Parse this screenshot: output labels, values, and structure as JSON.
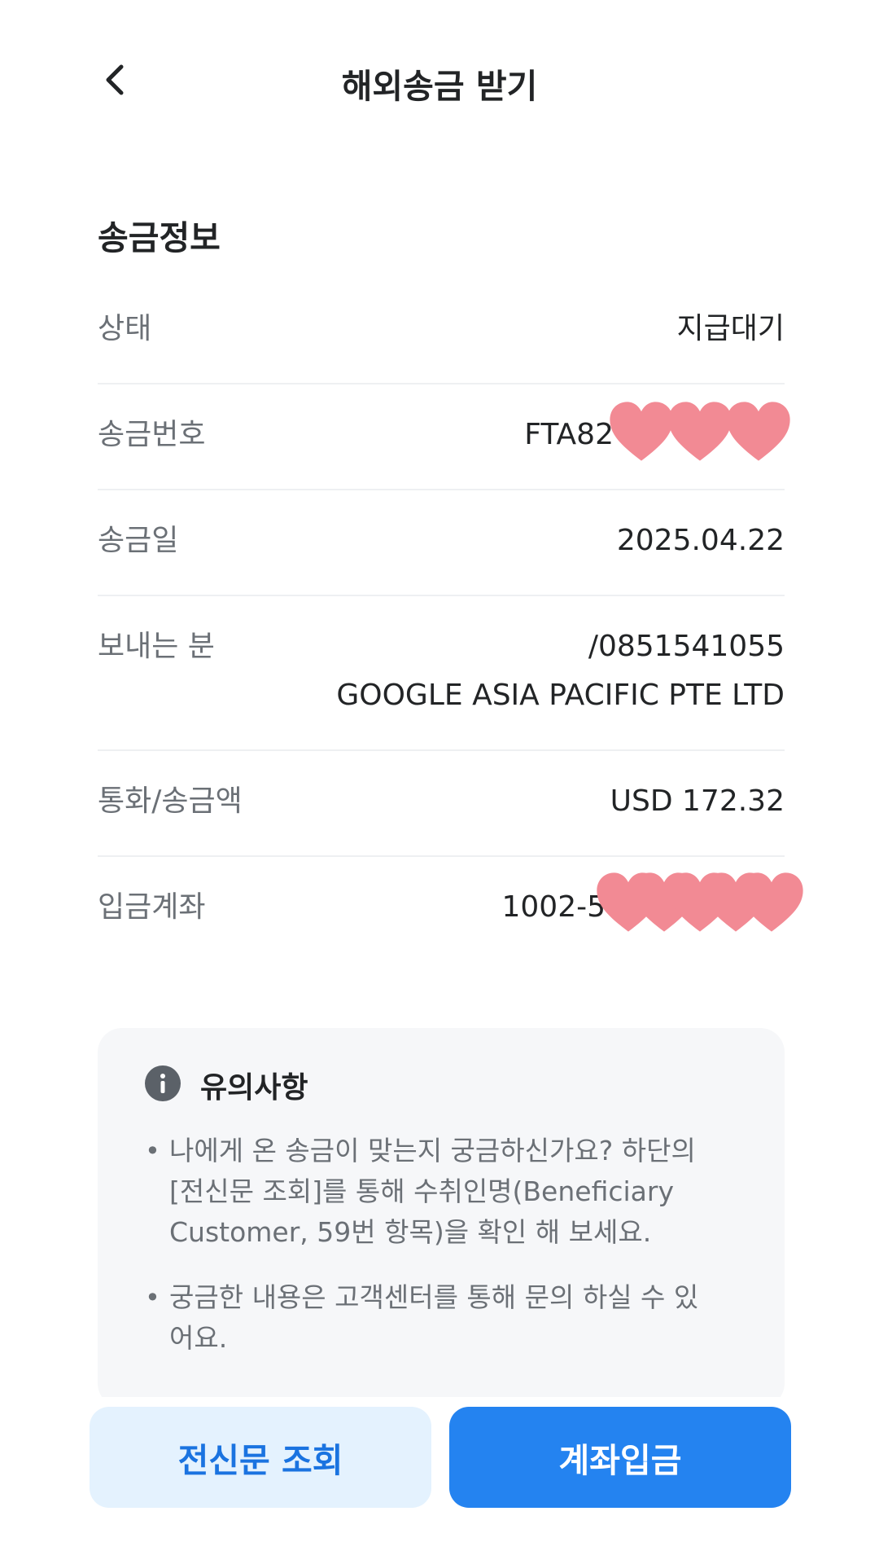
{
  "header": {
    "title": "해외송금 받기",
    "back_icon": "chevron-left-icon"
  },
  "section": {
    "title": "송금정보"
  },
  "info_rows": [
    {
      "label": "상태",
      "value": "지급대기"
    },
    {
      "label": "송금번호",
      "value": "FTA82"
    },
    {
      "label": "송금일",
      "value": "2025.04.22"
    },
    {
      "label": "보내는 분",
      "value": "/0851541055",
      "value2": "GOOGLE ASIA PACIFIC PTE LTD"
    },
    {
      "label": "통화/송금액",
      "value": "USD 172.32"
    },
    {
      "label": "입금계좌",
      "value": "1002-5"
    }
  ],
  "notice": {
    "icon": "info-icon",
    "title": "유의사항",
    "bullets": [
      "나에게 온 송금이 맞는지 궁금하신가요? 하단의 [전신문 조회]를 통해 수취인명(Beneficiary Customer, 59번 항목)을 확인 해 보세요.",
      "궁금한 내용은 고객센터를 통해 문의 하실 수 있어요."
    ]
  },
  "footer": {
    "secondary_label": "전신문 조회",
    "primary_label": "계좌입금"
  },
  "colors": {
    "primary": "#2483f0",
    "secondary_bg": "#e4f2fe",
    "secondary_text": "#1a73e0",
    "heart": "#f28a94"
  }
}
